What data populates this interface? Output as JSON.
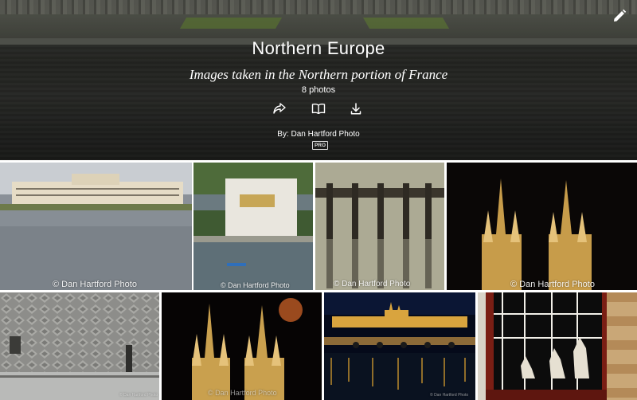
{
  "album": {
    "title": "Northern Europe",
    "description": "Images taken in the Northern portion of France",
    "count": "8 photos",
    "author": "By: Dan Hartford Photo",
    "badge": "PRO"
  },
  "actions": [
    {
      "name": "share-icon"
    },
    {
      "name": "slideshow-icon"
    },
    {
      "name": "download-icon"
    }
  ],
  "edit_icon": "pencil-icon",
  "photos": [
    {
      "name": "photo-palace-lake",
      "watermark": "© Dan Hartford Photo"
    },
    {
      "name": "photo-lake-house",
      "watermark": "© Dan Hartford Photo"
    },
    {
      "name": "photo-pier-posts",
      "watermark": "© Dan Hartford Photo"
    },
    {
      "name": "photo-church-spires-night",
      "watermark": "© Dan Hartford Photo"
    },
    {
      "name": "photo-patterned-wall",
      "watermark": "© Dan Hartford Photo"
    },
    {
      "name": "photo-spires-moon",
      "watermark": "© Dan Hartford Photo"
    },
    {
      "name": "photo-prague-night",
      "watermark": "© Dan Hartford Photo"
    },
    {
      "name": "photo-window-cats",
      "watermark": ""
    }
  ]
}
